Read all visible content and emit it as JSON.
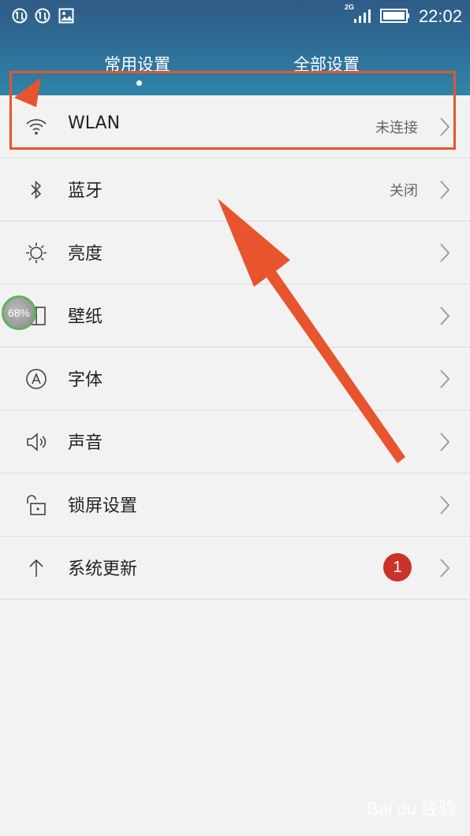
{
  "status_bar": {
    "time": "22:02",
    "network_type": "2G",
    "icons": [
      "data-sync-icon",
      "data-sync-icon",
      "image-icon",
      "signal-icon",
      "battery-icon"
    ]
  },
  "tabs": [
    {
      "label": "常用设置",
      "active": true
    },
    {
      "label": "全部设置",
      "active": false
    }
  ],
  "settings": [
    {
      "label": "WLAN",
      "value": "未连接",
      "icon": "wifi-icon"
    },
    {
      "label": "蓝牙",
      "value": "关闭",
      "icon": "bluetooth-icon"
    },
    {
      "label": "亮度",
      "value": "",
      "icon": "brightness-icon"
    },
    {
      "label": "壁纸",
      "value": "",
      "icon": "wallpaper-icon"
    },
    {
      "label": "字体",
      "value": "",
      "icon": "font-icon"
    },
    {
      "label": "声音",
      "value": "",
      "icon": "sound-icon"
    },
    {
      "label": "锁屏设置",
      "value": "",
      "icon": "lock-screen-icon"
    },
    {
      "label": "系统更新",
      "value": "",
      "badge": "1",
      "icon": "arrow-up-icon"
    }
  ],
  "floating_ball": {
    "text": "68%"
  },
  "watermark": {
    "text": "Bai du 经验"
  },
  "colors": {
    "header_top": "#2f5c86",
    "header_bottom": "#2f85a9",
    "background": "#f2f2f2",
    "annotation": "#e8542d",
    "badge": "#c9332a"
  }
}
